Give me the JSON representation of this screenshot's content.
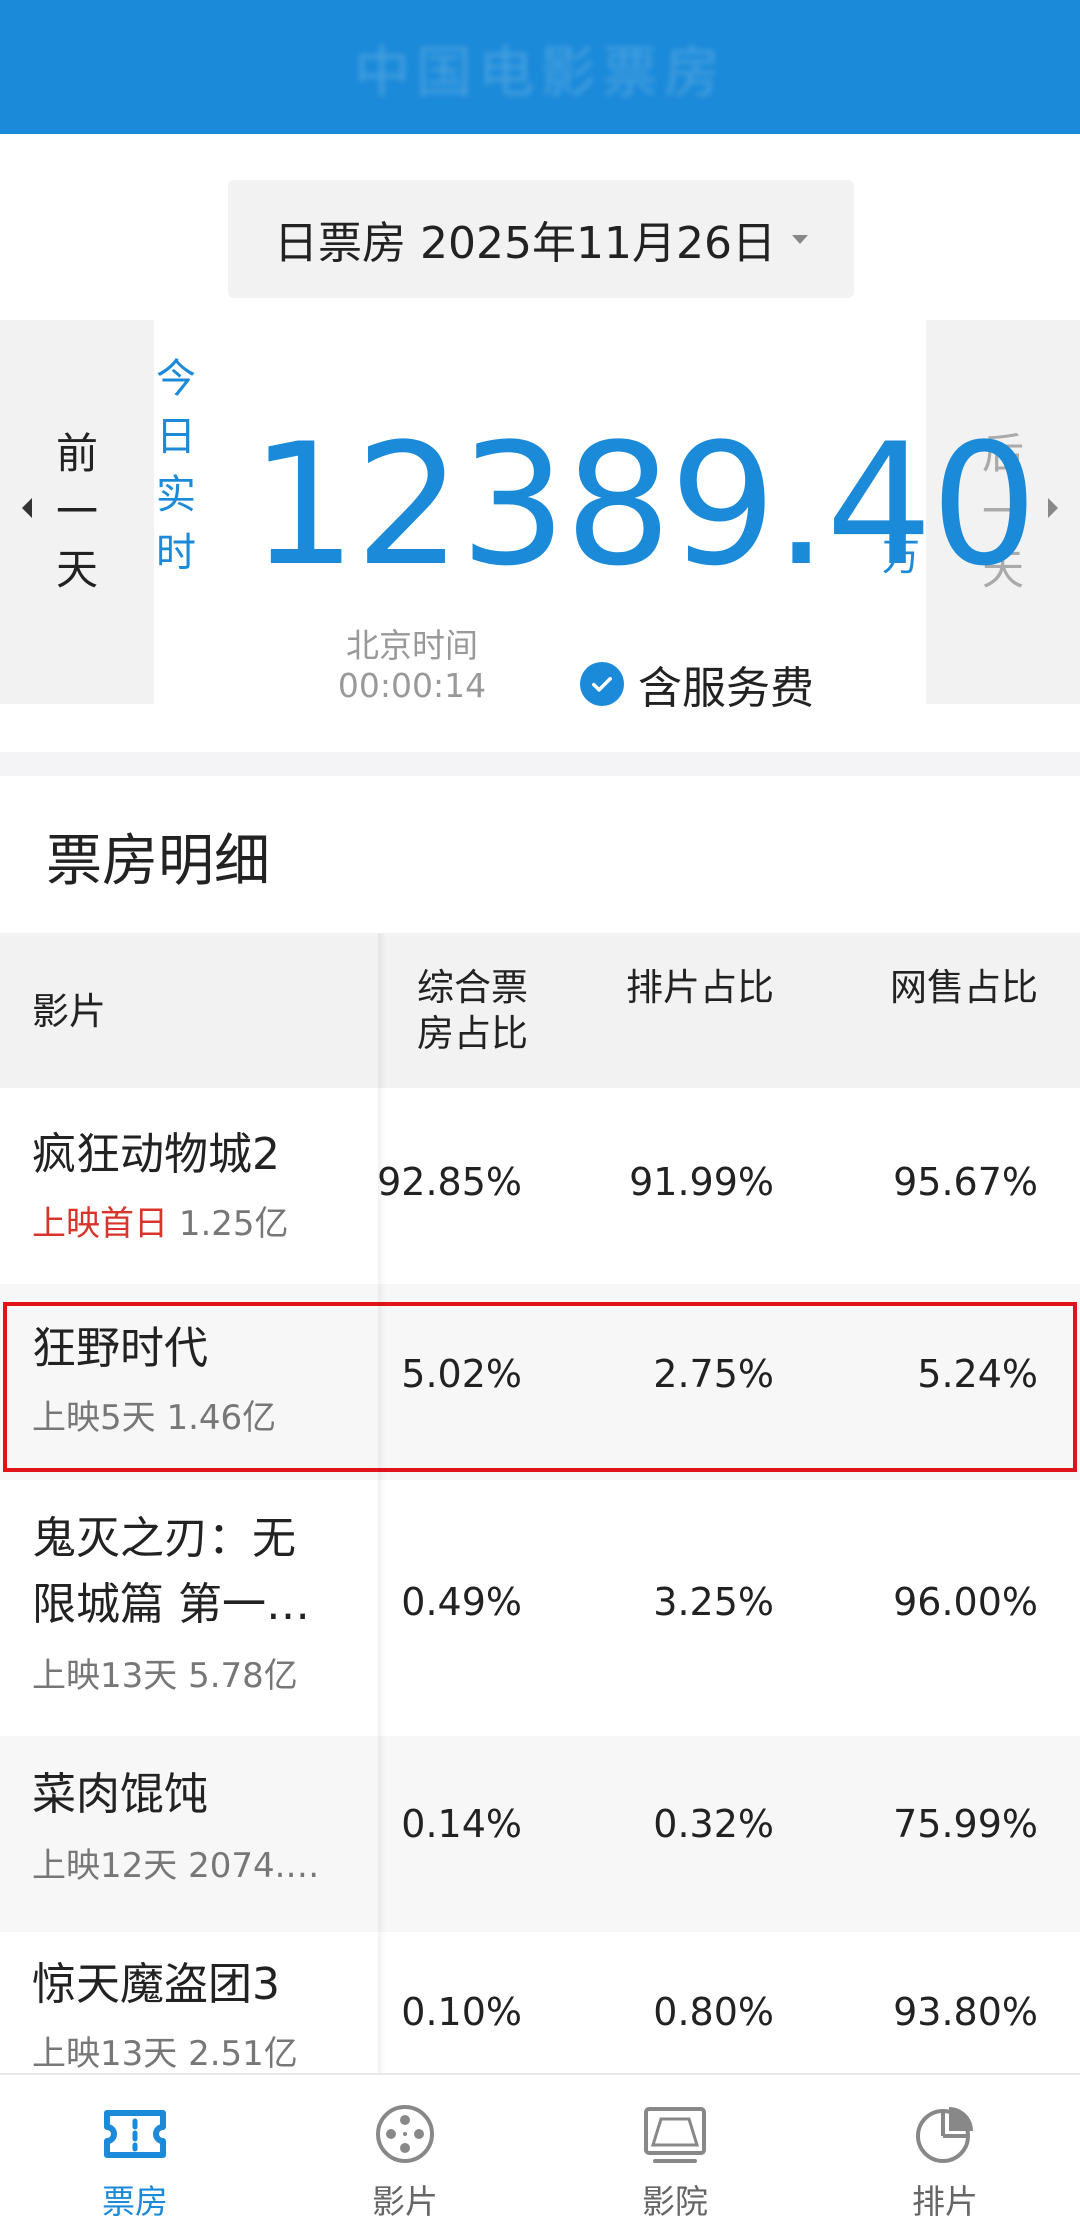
{
  "header": {
    "title": "中国电影票房"
  },
  "date_selector": {
    "label": "日票房 2025年11月26日"
  },
  "nav": {
    "prev": [
      "前",
      "一",
      "天"
    ],
    "next": [
      "后",
      "一",
      "天"
    ]
  },
  "realtime": {
    "label": [
      "今",
      "日",
      "实",
      "时"
    ],
    "value": "12389.40",
    "unit": "万",
    "time_label": "北京时间",
    "time_value": "00:00:14",
    "fee_label": "含服务费",
    "fee_checked": true
  },
  "section_title": "票房明细",
  "table": {
    "headers": {
      "film": "影片",
      "share": "综合票房占比",
      "schedule": "排片占比",
      "online": "网售占比"
    },
    "rows": [
      {
        "name": "疯狂动物城2",
        "tag": "上映首日",
        "sub": "1.25亿",
        "share": "92.85%",
        "schedule": "91.99%",
        "online": "95.67%"
      },
      {
        "name": "狂野时代",
        "tag": "",
        "sub": "上映5天 1.46亿",
        "share": "5.02%",
        "schedule": "2.75%",
        "online": "5.24%",
        "highlighted": true
      },
      {
        "name": "鬼灭之刃：无限城篇 第一…",
        "name_line1": "鬼灭之刃：无",
        "name_line2": "限城篇 第一…",
        "tag": "",
        "sub": "上映13天 5.78亿",
        "share": "0.49%",
        "schedule": "3.25%",
        "online": "96.00%"
      },
      {
        "name": "菜肉馄饨",
        "tag": "",
        "sub": "上映12天 2074.…",
        "share": "0.14%",
        "schedule": "0.32%",
        "online": "75.99%"
      },
      {
        "name": "惊天魔盗团3",
        "tag": "",
        "sub": "上映13天 2.51亿",
        "share": "0.10%",
        "schedule": "0.80%",
        "online": "93.80%"
      }
    ]
  },
  "tabbar": {
    "items": [
      {
        "label": "票房",
        "icon": "ticket-icon",
        "active": true
      },
      {
        "label": "影片",
        "icon": "film-reel-icon",
        "active": false
      },
      {
        "label": "影院",
        "icon": "cinema-screen-icon",
        "active": false
      },
      {
        "label": "排片",
        "icon": "pie-chart-icon",
        "active": false
      }
    ]
  },
  "colors": {
    "accent": "#1b8ad9",
    "highlight": "#e1141b",
    "tag_red": "#d9342b"
  }
}
